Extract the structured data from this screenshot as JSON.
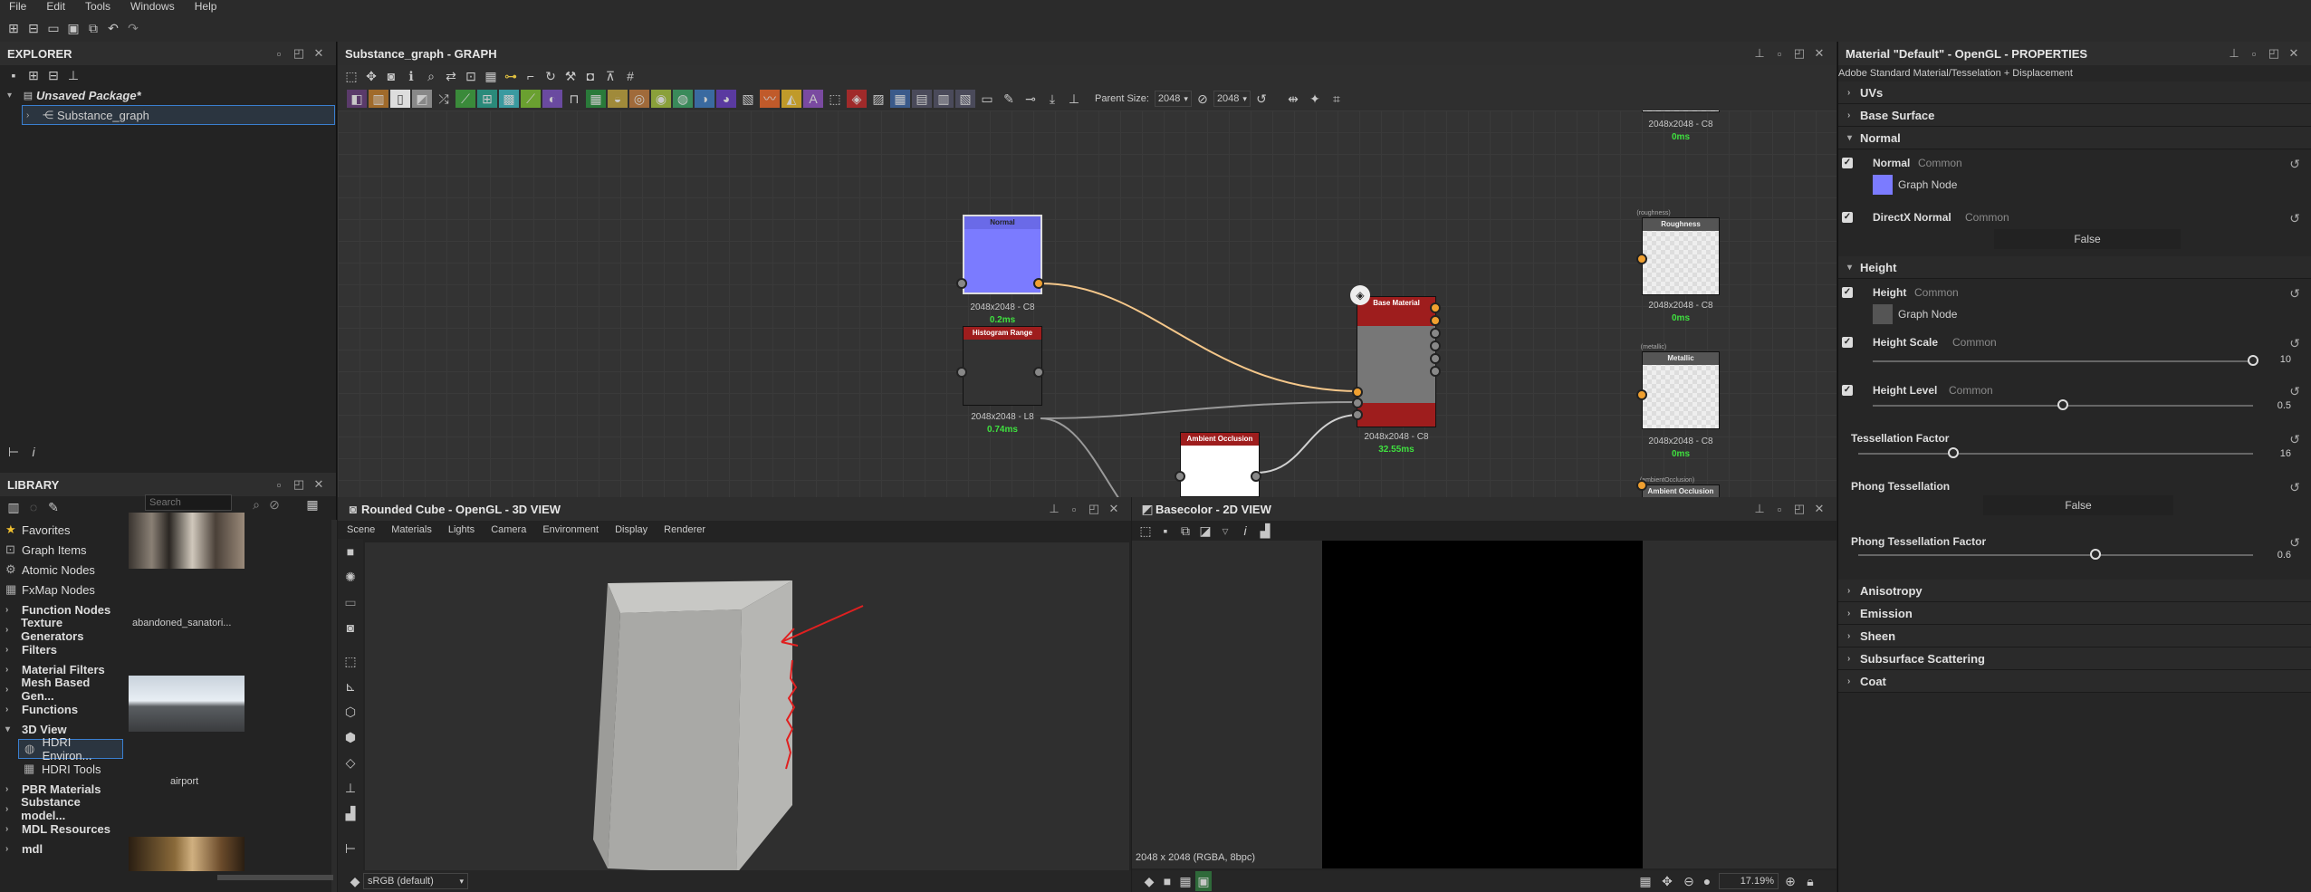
{
  "menu": [
    "File",
    "Edit",
    "Tools",
    "Windows",
    "Help"
  ],
  "explorer": {
    "title": "EXPLORER",
    "package": "Unsaved Package*",
    "graph_item": "Substance_graph"
  },
  "library": {
    "title": "LIBRARY",
    "search_placeholder": "Search",
    "categories": [
      {
        "label": "Favorites",
        "bold": false,
        "icon": "star-icon"
      },
      {
        "label": "Graph Items",
        "bold": false,
        "icon": "graph-icon"
      },
      {
        "label": "Atomic Nodes",
        "bold": false,
        "icon": "atomic-icon"
      },
      {
        "label": "FxMap Nodes",
        "bold": false,
        "icon": "fxmap-icon"
      },
      {
        "label": "Function Nodes",
        "bold": true
      },
      {
        "label": "Texture Generators",
        "bold": true
      },
      {
        "label": "Filters",
        "bold": true
      },
      {
        "label": "Material Filters",
        "bold": true
      },
      {
        "label": "Mesh Based Gen...",
        "bold": true
      },
      {
        "label": "Functions",
        "bold": true
      },
      {
        "label": "3D View",
        "bold": true
      },
      {
        "label": "HDRI Environ...",
        "bold": false,
        "sub": true,
        "selected": true
      },
      {
        "label": "HDRI Tools",
        "bold": false,
        "sub": true
      },
      {
        "label": "PBR Materials",
        "bold": true
      },
      {
        "label": "Substance model...",
        "bold": true
      },
      {
        "label": "MDL Resources",
        "bold": true
      },
      {
        "label": "mdl",
        "bold": true
      }
    ],
    "assets": [
      "abandoned_sanatori...",
      "airport"
    ]
  },
  "graph": {
    "title": "Substance_graph - GRAPH",
    "parent_size_label": "Parent Size:",
    "parent_size": "2048",
    "size_value": "2048",
    "nodes": {
      "normal": {
        "title": "Normal",
        "res": "2048x2048 - C8",
        "time": "0.2ms"
      },
      "histogram": {
        "title": "Histogram Range",
        "res": "2048x2048 - L8",
        "time": "0.74ms"
      },
      "ao_small": {
        "title": "Ambient Occlusion (HB..."
      },
      "base": {
        "title": "Base Material",
        "res": "2048x2048 - C8",
        "time": "32.55ms"
      },
      "out_top": {
        "res": "2048x2048 - C8",
        "time": "0ms"
      },
      "roughness": {
        "tag": "(roughness)",
        "title": "Roughness",
        "res": "2048x2048 - C8",
        "time": "0ms"
      },
      "metallic": {
        "tag": "(metallic)",
        "title": "Metallic",
        "res": "2048x2048 - C8",
        "time": "0ms"
      },
      "ao_out": {
        "tag": "(ambientOcclusion)",
        "title": "Ambient Occlusion"
      }
    }
  },
  "view3d": {
    "title": "Rounded Cube - OpenGL - 3D VIEW",
    "menu": [
      "Scene",
      "Materials",
      "Lights",
      "Camera",
      "Environment",
      "Display",
      "Renderer"
    ],
    "colorspace": "sRGB (default)"
  },
  "view2d": {
    "title": "Basecolor - 2D VIEW",
    "info": "2048 x 2048 (RGBA, 8bpc)",
    "zoom": "17.19%"
  },
  "props": {
    "title": "Material \"Default\" - OpenGL - PROPERTIES",
    "subtitle": "Adobe Standard Material/Tesselation + Displacement",
    "sections_top": [
      "UVs",
      "Base Surface"
    ],
    "normal_section": "Normal",
    "normal": {
      "label": "Normal",
      "tag": "Common",
      "value": "Graph Node",
      "swatch": "#7b7bff"
    },
    "directx": {
      "label": "DirectX Normal",
      "tag": "Common",
      "value": "False"
    },
    "height_section": "Height",
    "height": {
      "label": "Height",
      "tag": "Common",
      "value": "Graph Node",
      "swatch": "#555555"
    },
    "height_scale": {
      "label": "Height Scale",
      "tag": "Common",
      "value": "10",
      "fraction": 1.0
    },
    "height_level": {
      "label": "Height Level",
      "tag": "Common",
      "value": "0.5",
      "fraction": 0.5
    },
    "tess_factor": {
      "label": "Tessellation Factor",
      "value": "16",
      "fraction": 0.24
    },
    "phong": {
      "label": "Phong Tessellation",
      "value": "False"
    },
    "phong_factor": {
      "label": "Phong Tessellation Factor",
      "value": "0.6",
      "fraction": 0.6
    },
    "sections_bottom": [
      "Anisotropy",
      "Emission",
      "Sheen",
      "Subsurface Scattering",
      "Coat"
    ]
  },
  "colors": {
    "accent": "#4a90d9",
    "node_red": "#9e1d1d",
    "normal_blue": "#7b7bff",
    "time_green": "#3fe03f",
    "wire_orange": "#f5c78a"
  }
}
